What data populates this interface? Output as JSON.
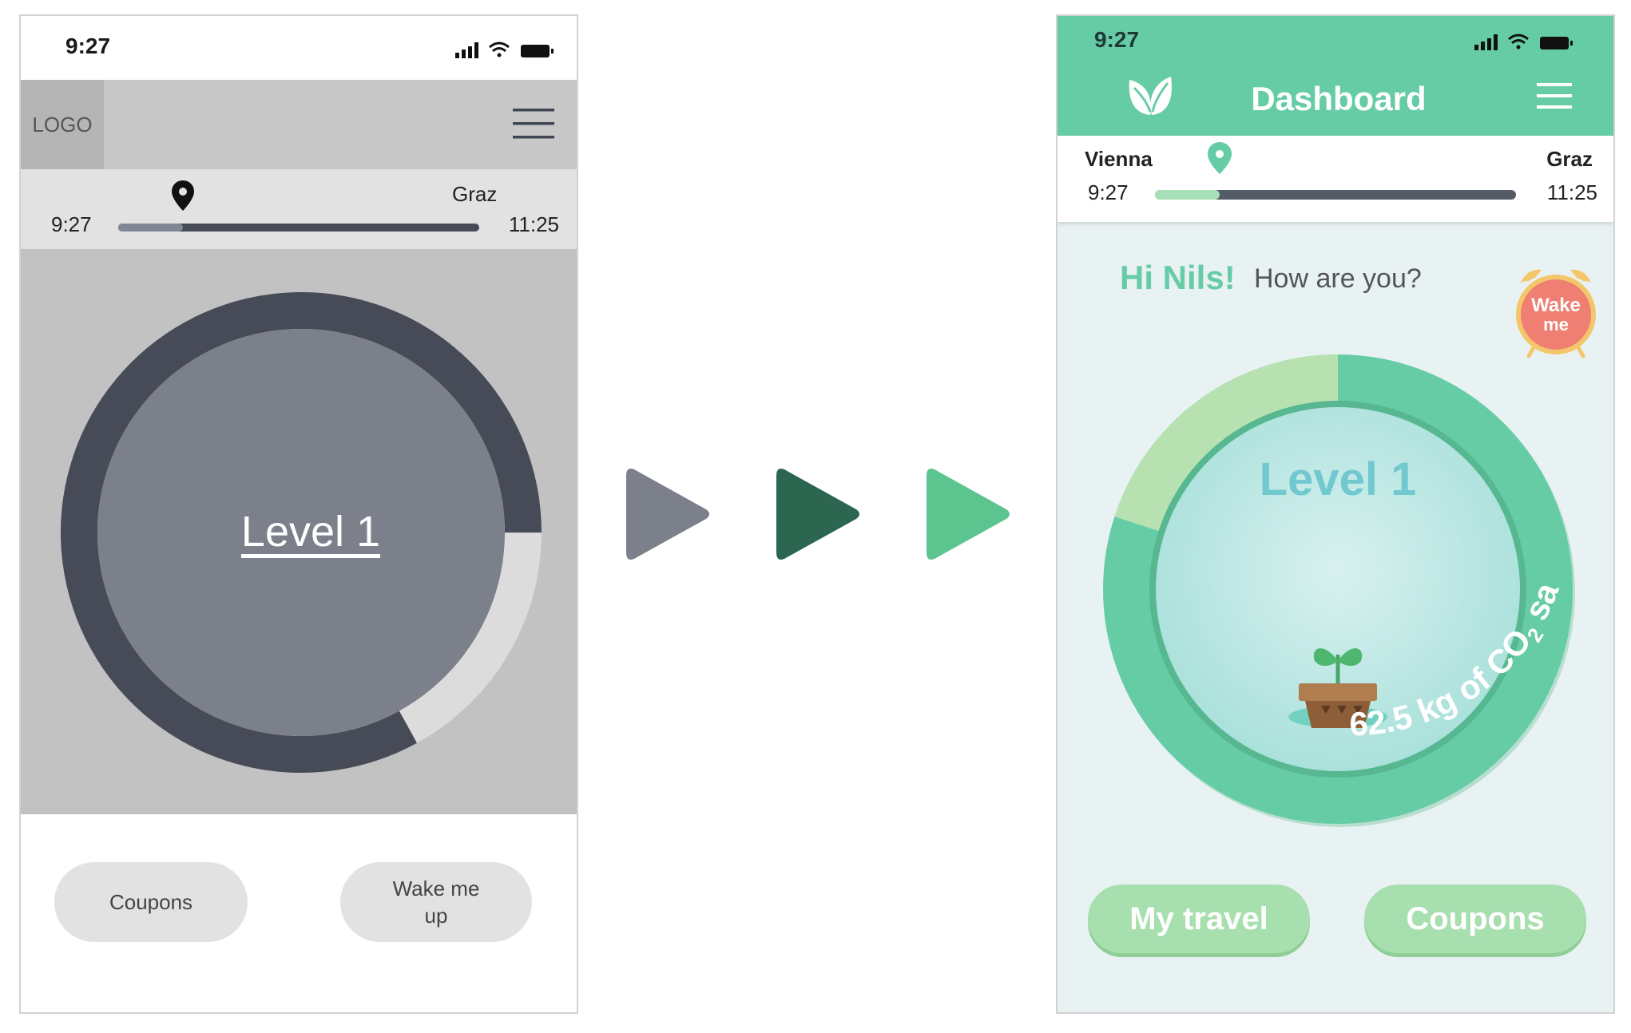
{
  "colors": {
    "wire_gray": "#c2c2c2",
    "wire_dark": "#474b57",
    "brand_green": "#66cca6",
    "light_green": "#a8dfae",
    "arrow_1": "#7b808b",
    "arrow_2": "#2c6651",
    "arrow_3": "#5bc48f",
    "alarm_red": "#ef7f73"
  },
  "wireframe": {
    "status_time": "9:27",
    "logo": "LOGO",
    "trip": {
      "destination": "Graz",
      "start_time": "9:27",
      "end_time": "11:25",
      "progress": 0.18
    },
    "progress_ring": 0.83,
    "level": "Level 1",
    "buttons": [
      "Coupons",
      "Wake me up"
    ]
  },
  "arrows": [
    "gray",
    "dark-green",
    "green"
  ],
  "design": {
    "status_time": "9:27",
    "title": "Dashboard",
    "trip": {
      "origin": "Vienna",
      "destination": "Graz",
      "start_time": "9:27",
      "end_time": "11:25",
      "progress": 0.18
    },
    "greeting": "Hi Nils!",
    "subgreeting": "How are you?",
    "alarm": {
      "line1": "Wake",
      "line2": "me"
    },
    "level": "Level 1",
    "co2_amount": "62.5 kg of CO",
    "co2_subscript": "2",
    "co2_suffix": " saved",
    "buttons": [
      "My travel",
      "Coupons"
    ]
  }
}
